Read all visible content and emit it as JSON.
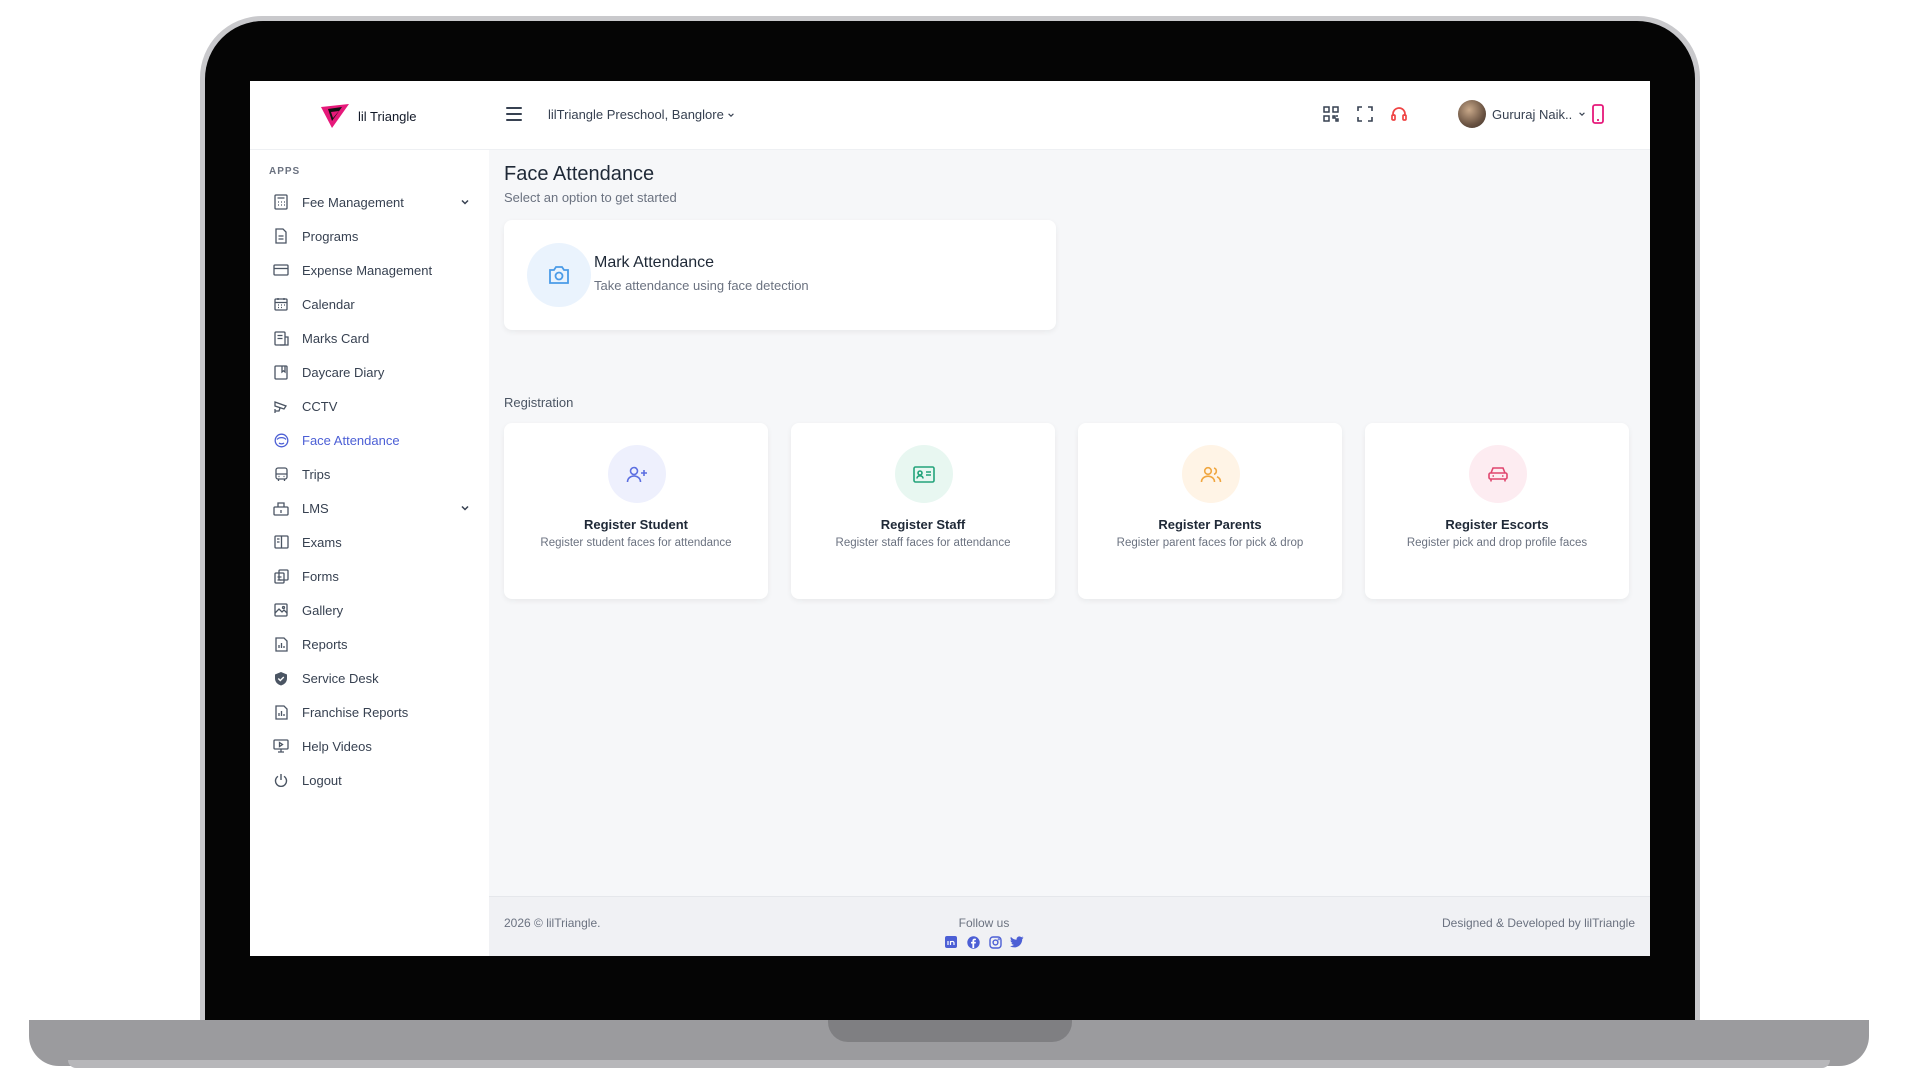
{
  "app": {
    "logo_text": "lil Triangle",
    "school": "lilTriangle Preschool, Banglore"
  },
  "header": {
    "user_name": "Gururaj Naik..",
    "icons": [
      "qr-code-icon",
      "fullscreen-icon",
      "headset-icon",
      "phone-icon"
    ]
  },
  "sidebar": {
    "section_label": "APPS",
    "items": [
      {
        "label": "Fee Management",
        "icon": "calculator-icon",
        "has_submenu": true
      },
      {
        "label": "Programs",
        "icon": "document-icon"
      },
      {
        "label": "Expense Management",
        "icon": "credit-card-icon"
      },
      {
        "label": "Calendar",
        "icon": "calendar-icon"
      },
      {
        "label": "Marks Card",
        "icon": "marks-card-icon"
      },
      {
        "label": "Daycare Diary",
        "icon": "diary-icon"
      },
      {
        "label": "CCTV",
        "icon": "cctv-icon"
      },
      {
        "label": "Face Attendance",
        "icon": "face-icon",
        "active": true
      },
      {
        "label": "Trips",
        "icon": "bus-icon"
      },
      {
        "label": "LMS",
        "icon": "lms-icon",
        "has_submenu": true
      },
      {
        "label": "Exams",
        "icon": "book-icon"
      },
      {
        "label": "Forms",
        "icon": "forms-icon"
      },
      {
        "label": "Gallery",
        "icon": "image-icon"
      },
      {
        "label": "Reports",
        "icon": "report-icon"
      },
      {
        "label": "Service Desk",
        "icon": "shield-icon"
      },
      {
        "label": "Franchise Reports",
        "icon": "report-icon"
      },
      {
        "label": "Help Videos",
        "icon": "monitor-icon"
      },
      {
        "label": "Logout",
        "icon": "power-icon"
      }
    ]
  },
  "main": {
    "title": "Face Attendance",
    "subtitle": "Select an option to get started",
    "mark_card": {
      "title": "Mark Attendance",
      "subtitle": "Take attendance using face detection",
      "icon": "camera-icon"
    },
    "section_label": "Registration",
    "reg_cards": [
      {
        "title": "Register Student",
        "subtitle": "Register student faces for attendance",
        "icon": "user-plus-icon",
        "color": "#5b6ee1",
        "bg": "#eef0fd"
      },
      {
        "title": "Register Staff",
        "subtitle": "Register staff faces for attendance",
        "icon": "id-card-icon",
        "color": "#22a37a",
        "bg": "#e8f7f1"
      },
      {
        "title": "Register Parents",
        "subtitle": "Register parent faces for pick & drop",
        "icon": "users-icon",
        "color": "#f0a640",
        "bg": "#fff4e6"
      },
      {
        "title": "Register Escorts",
        "subtitle": "Register pick and drop profile faces",
        "icon": "car-icon",
        "color": "#e0456e",
        "bg": "#fdecf1"
      }
    ]
  },
  "footer": {
    "copyright": "2026 © lilTriangle.",
    "follow": "Follow us",
    "credit": "Designed & Developed by lilTriangle",
    "social": [
      "linkedin-icon",
      "facebook-icon",
      "instagram-icon",
      "twitter-icon"
    ]
  },
  "colors": {
    "accent": "#4c5fd5",
    "brand_pink": "#e6197a",
    "headset_red": "#ef4444"
  }
}
